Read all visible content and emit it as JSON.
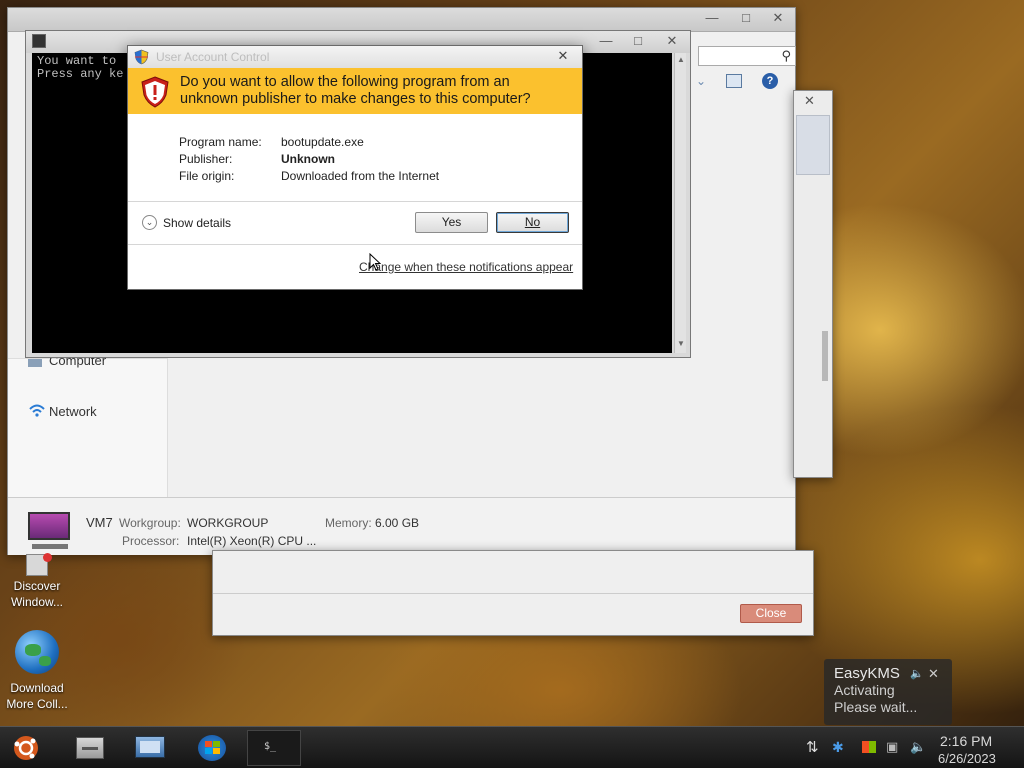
{
  "uac": {
    "title": "User Account Control",
    "question": "Do you want to allow the following program from an unknown publisher to make changes to this computer?",
    "program_label": "Program name:",
    "program_value": "bootupdate.exe",
    "publisher_label": "Publisher:",
    "publisher_value": "Unknown",
    "origin_label": "File origin:",
    "origin_value": "Downloaded from the Internet",
    "details_label": "Show details",
    "yes_label": "Yes",
    "no_label": "No",
    "change_link": "Change when these notifications appear"
  },
  "cmd": {
    "line1": "You want to",
    "line2": "Press any ke"
  },
  "system": {
    "computer_label": "Computer",
    "network_label": "Network",
    "vm_name": "VM7",
    "workgroup_label": "Workgroup:",
    "workgroup_value": "WORKGROUP",
    "memory_label": "Memory:",
    "memory_value": "6.00 GB",
    "processor_label": "Processor:",
    "processor_value": "Intel(R) Xeon(R) CPU ..."
  },
  "discover_window": {
    "close_label": "Close"
  },
  "desktop": {
    "discover_line1": "Discover",
    "discover_line2": "Window...",
    "download_line1": "Download",
    "download_line2": "More Coll..."
  },
  "notification": {
    "title": "EasyKMS",
    "line1": "Activating",
    "line2": "Please wait..."
  },
  "taskbar": {
    "time": "2:16 PM",
    "date": "6/26/2023"
  },
  "colors": {
    "uac_header": "#fbc12e",
    "close_button": "#d98b7a"
  }
}
